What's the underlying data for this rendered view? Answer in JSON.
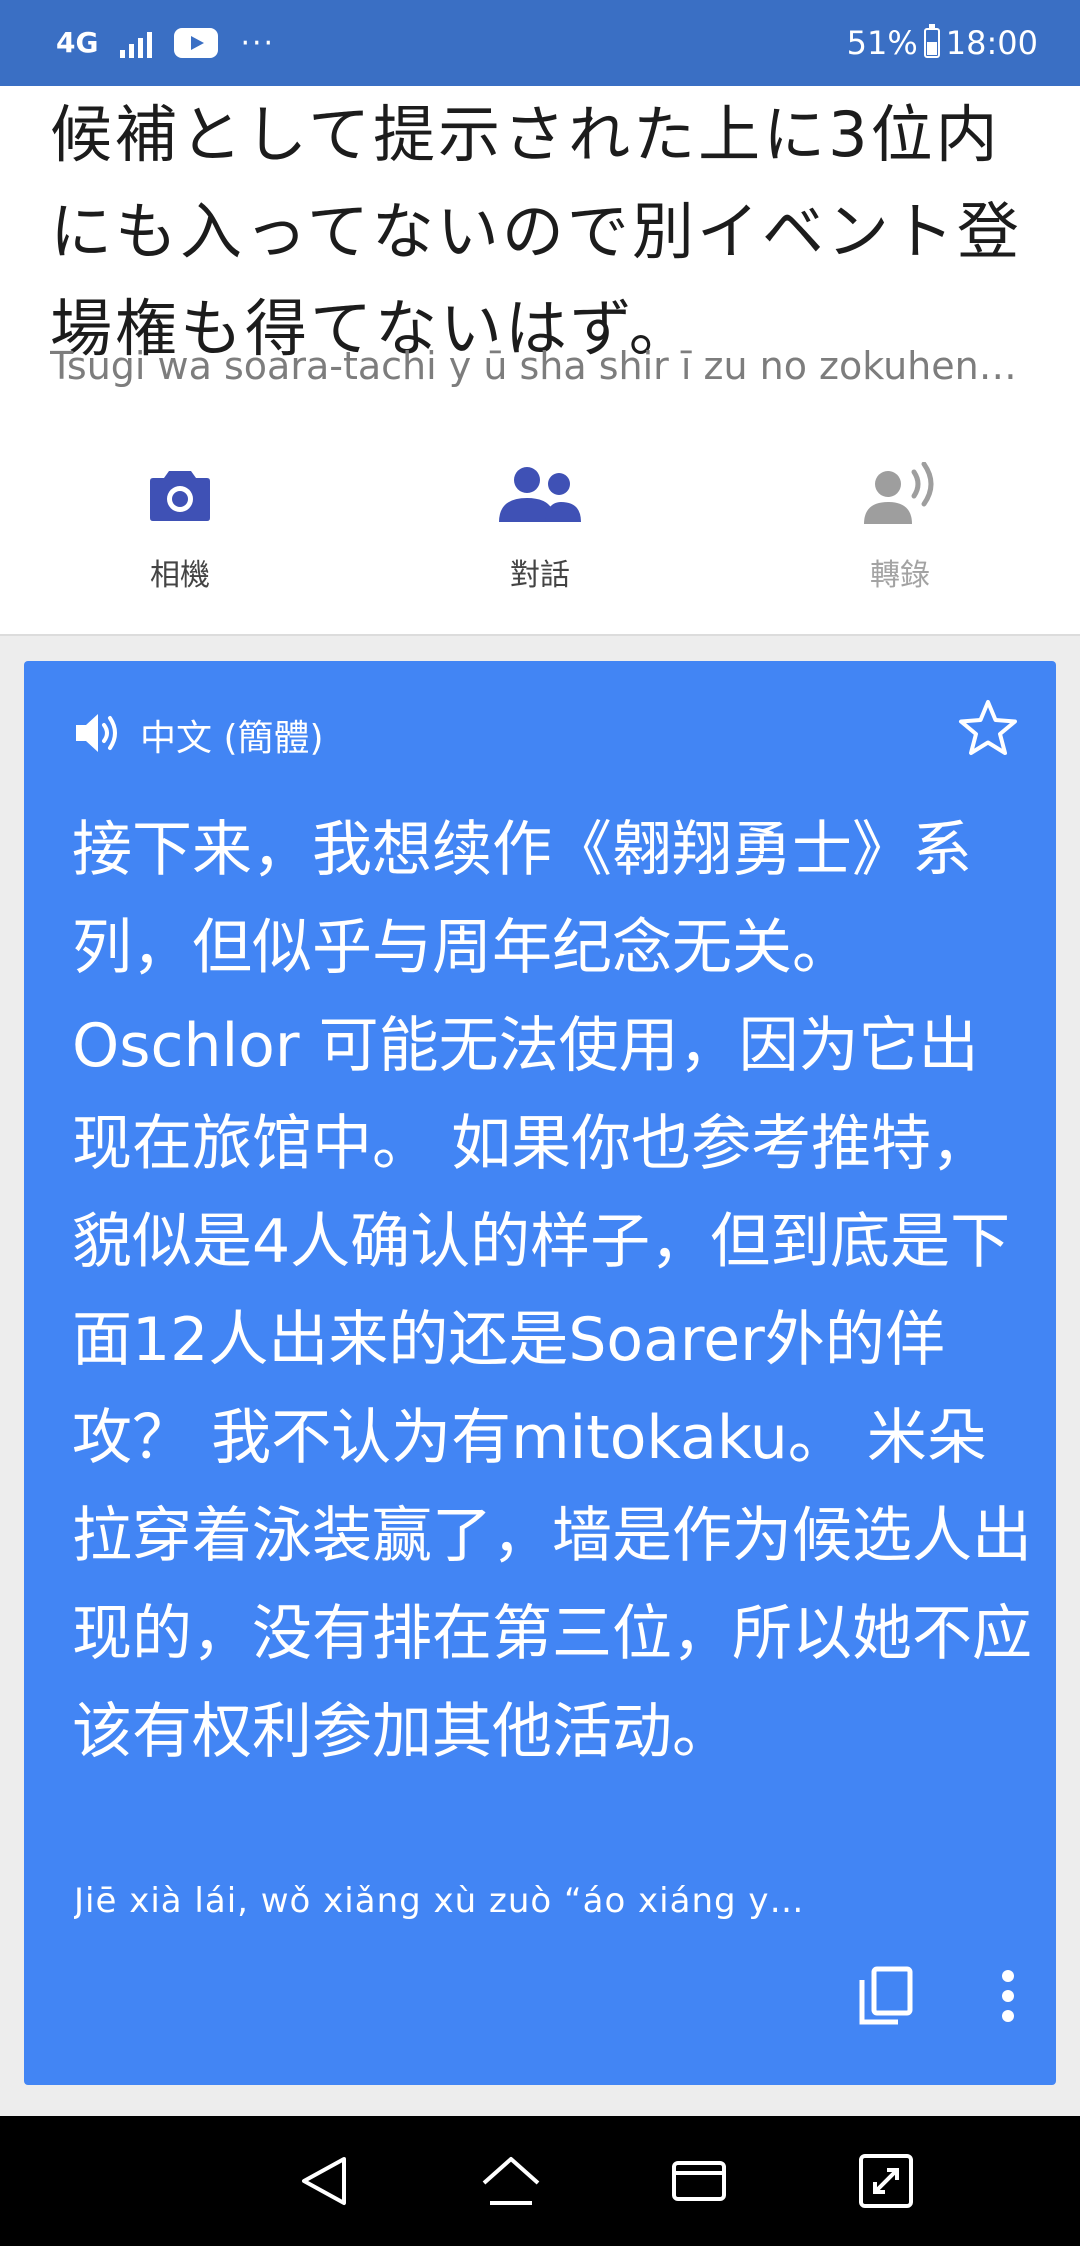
{
  "status_bar": {
    "network": "4G",
    "dots": "···",
    "battery": "51%",
    "time": "18:00"
  },
  "source": {
    "text": "候補として提示された上に3位内にも入ってないので別イベント登場権も得てないはず。",
    "romaji": "Tsugi wa soara-tachi y ū sha shir ī zu no zokuhen …"
  },
  "tools": [
    {
      "icon": "camera-icon",
      "label": "相機"
    },
    {
      "icon": "conversation-icon",
      "label": "對話"
    },
    {
      "icon": "transcribe-icon",
      "label": "轉錄"
    }
  ],
  "translation": {
    "language": "中文 (簡體)",
    "text": "接下来，我想续作《翱翔勇士》系列，但似乎与周年纪念无关。Oschlor 可能无法使用，因为它出现在旅馆中。 如果你也参考推特，貌似是4人确认的样子，但到底是下面12人出来的还是Soarer外的佯攻？ 我不认为有mitokaku。 米朵拉穿着泳装赢了，墙是作为候选人出现的，没有排在第三位，所以她不应该有权利参加其他活动。",
    "pinyin": "Jiē xià lái, wǒ xiǎng xù zuò “áo xiáng y…"
  },
  "colors": {
    "status_bar": "#3a6fc4",
    "card": "#4285f4",
    "icon_blue": "#3f51b5",
    "icon_disabled": "#9e9e9e"
  }
}
